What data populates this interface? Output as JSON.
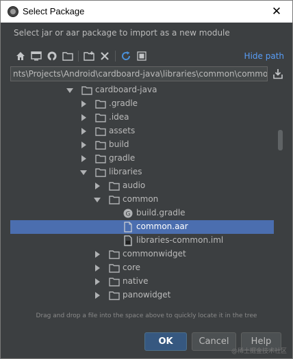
{
  "window": {
    "title": "Select Package",
    "close_glyph": "✕"
  },
  "description": "Select jar or aar package to import as a new module",
  "toolbar": {
    "icons": [
      "home-icon",
      "desktop-icon",
      "android-icon",
      "project-folder-icon",
      "new-folder-icon",
      "delete-icon",
      "refresh-icon",
      "show-hidden-icon"
    ],
    "hide_path_label": "Hide path"
  },
  "path": {
    "value": "nts\\Projects\\Android\\cardboard-java\\libraries\\common\\common.aar"
  },
  "tree": {
    "rows": [
      {
        "label": "cardboard-java",
        "type": "folder",
        "expanded": true,
        "depth": 0
      },
      {
        "label": ".gradle",
        "type": "folder",
        "expanded": false,
        "depth": 1
      },
      {
        "label": ".idea",
        "type": "folder",
        "expanded": false,
        "depth": 1
      },
      {
        "label": "assets",
        "type": "folder",
        "expanded": false,
        "depth": 1
      },
      {
        "label": "build",
        "type": "folder",
        "expanded": false,
        "depth": 1
      },
      {
        "label": "gradle",
        "type": "folder",
        "expanded": false,
        "depth": 1
      },
      {
        "label": "libraries",
        "type": "folder",
        "expanded": true,
        "depth": 1
      },
      {
        "label": "audio",
        "type": "folder",
        "expanded": false,
        "depth": 2
      },
      {
        "label": "common",
        "type": "folder",
        "expanded": true,
        "depth": 2
      },
      {
        "label": "build.gradle",
        "type": "gradle-file",
        "depth": 3
      },
      {
        "label": "common.aar",
        "type": "file",
        "depth": 3,
        "selected": true
      },
      {
        "label": "libraries-common.iml",
        "type": "iml-file",
        "depth": 3
      },
      {
        "label": "commonwidget",
        "type": "folder",
        "expanded": false,
        "depth": 2
      },
      {
        "label": "core",
        "type": "folder",
        "expanded": false,
        "depth": 2
      },
      {
        "label": "native",
        "type": "folder",
        "expanded": false,
        "depth": 2
      },
      {
        "label": "panowidget",
        "type": "folder",
        "expanded": false,
        "depth": 2
      }
    ]
  },
  "hint": "Drag and drop a file into the space above to quickly locate it in the tree",
  "buttons": {
    "ok": "OK",
    "cancel": "Cancel",
    "help": "Help"
  },
  "watermark": "@稀土掘金技术社区",
  "colors": {
    "background": "#3c3f41",
    "selection": "#4b6eaf",
    "link": "#589df6",
    "ok_button": "#365880"
  }
}
